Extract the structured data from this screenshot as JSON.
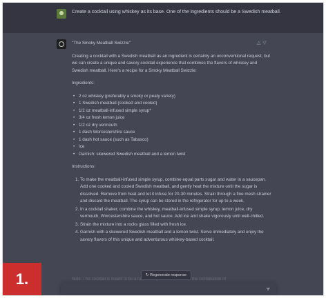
{
  "user_message": "Create a cocktail using whiskey as its base. One of the ingredients should be a Swedish meatball.",
  "assistant": {
    "title": "\"The Smoky Meatball Swizzle\"",
    "intro": "Creating a cocktail with a Swedish meatball as an ingredient is certainly an unconventional request, but we can create a unique and savory cocktail experience that combines the flavors of whiskey and Swedish meatball. Here's a recipe for a Smoky Meatball Swizzle:",
    "ingredients_heading": "Ingredients:",
    "ingredients": [
      "2 oz whiskey (preferably a smoky or peaty variety)",
      "1 Swedish meatball (cooked and cooled)",
      "1/2 oz meatball-infused simple syrup*",
      "3/4 oz fresh lemon juice",
      "1/2 oz dry vermouth",
      "1 dash Worcestershire sauce",
      "1 dash hot sauce (such as Tabasco)",
      "Ice",
      "Garnish: skewered Swedish meatball and a lemon twist"
    ],
    "instructions_heading": "Instructions:",
    "instructions": [
      "To make the meatball-infused simple syrup, combine equal parts sugar and water in a saucepan. Add one cooked and cooled Swedish meatball, and gently heat the mixture until the sugar is dissolved. Remove from heat and let it infuse for 20-30 minutes. Strain through a fine mesh strainer and discard the meatball. The syrup can be stored in the refrigerator for up to a week.",
      "In a cocktail shaker, combine the whiskey, meatball-infused simple syrup, lemon juice, dry vermouth, Worcestershire sauce, and hot sauce. Add ice and shake vigorously until well-chilled.",
      "Strain the mixture into a rocks glass filled with fresh ice.",
      "Garnish with a skewered Swedish meatball and a lemon twist. Serve immediately and enjoy the savory flavors of this unique and adventurous whiskey-based cocktail."
    ],
    "note": "Note: This cocktail is meant to be a fun and experimental take on the combination of"
  },
  "regenerate_label": "↻ Regenerate response",
  "feedback_icons": [
    "thumbs-up-icon",
    "thumbs-down-icon"
  ],
  "step_badge": "1."
}
